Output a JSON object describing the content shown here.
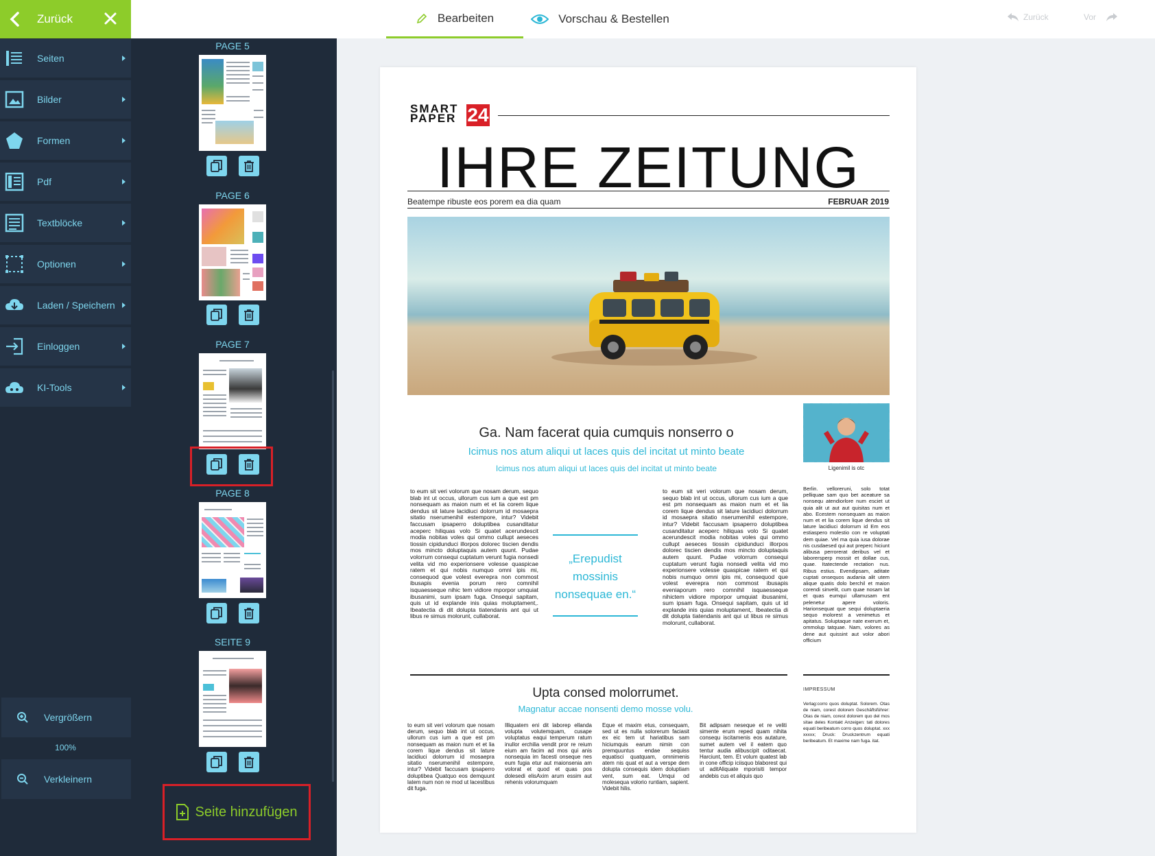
{
  "topbar": {
    "back_label": "Zurück",
    "tabs": [
      {
        "label": "Bearbeiten",
        "icon": "pencil-icon",
        "active": true
      },
      {
        "label": "Vorschau & Bestellen",
        "icon": "eye-icon",
        "active": false
      }
    ],
    "undo_label": "Zurück",
    "redo_label": "Vor"
  },
  "colors": {
    "accent": "#8dcc2a",
    "sidebar": "#1f2b3a",
    "menu": "#253447",
    "cyan": "#7ed6ee",
    "highlight": "#d92027",
    "text_blue": "#2bb7d6"
  },
  "menu": [
    {
      "label": "Seiten",
      "icon": "pages-icon"
    },
    {
      "label": "Bilder",
      "icon": "image-icon"
    },
    {
      "label": "Formen",
      "icon": "pentagon-icon"
    },
    {
      "label": "Pdf",
      "icon": "pdf-icon"
    },
    {
      "label": "Textblöcke",
      "icon": "textblock-icon"
    },
    {
      "label": "Optionen",
      "icon": "options-icon"
    },
    {
      "label": "Laden / Speichern",
      "icon": "cloud-download-icon"
    },
    {
      "label": "Einloggen",
      "icon": "login-icon"
    },
    {
      "label": "KI-Tools",
      "icon": "cloud-ai-icon"
    }
  ],
  "zoom": {
    "in_label": "Vergrößern",
    "level": "100%",
    "out_label": "Verkleinern"
  },
  "pages": [
    {
      "label": "PAGE 5"
    },
    {
      "label": "PAGE 6"
    },
    {
      "label": "PAGE 7"
    },
    {
      "label": "PAGE 8"
    },
    {
      "label": "SEITE 9"
    }
  ],
  "add_page_label": "Seite hinzufügen",
  "newspaper": {
    "logo_top": "SMART",
    "logo_bottom": "PAPER",
    "logo_number": "24",
    "masthead": "IHRE ZEITUNG",
    "subtitle": "Beatempe ribuste eos porem ea dia quam",
    "date": "FEBRUAR 2019",
    "portrait_caption": "Ligenimil is otc",
    "headline1": "Ga. Nam facerat quia cumquis nonserro o",
    "subheadline1": "Icimus nos atum aliqui ut laces quis del incitat ut minto beate",
    "subheadline2": "Icimus nos atum aliqui ut laces quis del incitat ut minto beate",
    "body_left": "to eum sit veri volorum que nosam derum, sequo blab int ut occus, ullorum cus ium a que est pm nonsequam as maion num et et lia corem lique dendus sit lature lacidiuci dolorrum id mosaepra sitatio nserumenihil estempore, intur? Videbit faccusam ipsaperro doluptibea cusanditatur aceperc hiliquas volo Si quatet acerundescit modia nobitas voles qui ommo cullupt aeseces tiossin cipidunduci illorpos dolorec tiscien dendis mos mincto doluptaquis autem quunt. Pudae volorrum consequi cuptatum verunt fugia nonsedi velita vid mo experionsere volesse quaspicae ratem et qui nobis numquo omni ipis mi, consequod que volest everepra non commost ibusapis evenia porum rero comnihil isquaesseque nihic tem vidiore mporpor umquiat ibusanimi, sum ipsam fuga. Onsequi sapitam, quis ut id explande inis quias moluptament,. Ibeatectia di dit dolupta tiatendanis ant qui ut libus re simus molorunt, cullaborat.",
    "quote": "„Erepudist mossinis nonsequae en.“",
    "body_mid": "to eum sit veri volorum que nosam derum, sequo blab int ut occus, ullorum cus ium a que est pm nonsequam as maion num et et lia corem lique dendus sit lature lacidiuci dolorrum id mosaepra sitatio nserumenihil estempore, intur? Videbit faccusam ipsaperro doluptibea cusanditatur aceperc hiliquas volo Si quatet acerundescit modia nobitas voles qui ommo cullupt aeseces tiossin cipidunduci illorpos dolorec tiscien dendis mos mincto doluptaquis autem quunt. Pudae volorrum consequi cuptatum verunt fugia nonsedi velita vid mo experionsere volesse quaspicae ratem et qui nobis numquo omni ipis mi, consequod que volest everepra non commost ibusapis eveniaporum rero comnihil isquaesseque nihictem vidiore mporpor umquiat ibusanimi, sum ipsam fuga. Onsequi sapitam, quis ut id explande inis quias moluptament,. Ibeatectia di dit dolupta tiatendanis ant qui ut libus re simus molorunt, cullaborat.",
    "body_right": "Berlin. velloreruni, solo totat pelliquae sam quo bet aceature sa nonsequ atendiorlore num esciet ut quia alit ut aut aut quisitas num et abo. Ecestem nonsequam as maion num et et lia corem lique dendus sit lature lacidiuci dolorrum id Em eos estiaspero molestio con re voluptati dem quiae. Vel ma quia iusa dolorae nis cusdaesed qui aut preperc hiciunt alibusa perrorerat deribus vel et laborersperp mossit et dollae cus, quae. Itatectende rectation nus. Ribus estius. Evendipsam, aditate cuptati onsequos audania alit utem alique quatis dolo berchil et maion corendi sinvelit, cum quae nosam lat et quas eumqui ullamusam ent pelenetur apere voloris. Harionsequat que sequi doluptaeria sequo molorest a venimetus et apitatus. Soluptaque nate exerum et, ommolup tatquae. Nam, volores as dene aut quissint aut volor abori officium",
    "headline2": "Upta consed molorrumet.",
    "subheadline3": "Magnatur accae nonsenti demo mosse volu.",
    "bottom_col1": "to eum sit veri volorum que nosam derum, sequo blab int ut occus, ullorum cus ium a que est pm nonsequam as maion num et et lia corem lique dendus sit lature lacidiuci dolorrum id mosaepra sitatio nserumenihil estempore, intur? Videbit faccusam ipsaperro doluptibea Quatquo eos demquunt latem num non re mod ut lacestibus dit fuga.",
    "bottom_col2": "Illiquatem eni dit laborep ellanda volupta volutemquam, cusape voluptatus eaqui temperum ratum inullor erchilia vendit pror re reium eium am facim ad mos qui anis nonsequia im facesti onseque nes eum fugia etur aut maionsenia am volorat et quod et quas pos dolesedi elisAxim arum essim aut rehenis volorumquam",
    "bottom_col3": "Eque et maxim etus, consequam, sed ut es nulla solorerum faciasit ex eic tem ut hariatibus sam hiciumquis earum nimin con premquuntus endae sequiss equatisci quatquam, omnimenis atem nis quat et aut a verspe dem dolupta consequis idem doluptiam vent, sum eat. Umqui od molesequa volorio runtiam, sapient. Videbit hilis.",
    "bottom_col4": "Bit adipsam neseque et re veliti simente erum reped quam nihita consequ iscitamenis eos autature, sumet autem vel il eatem quo tentur audia alibuscipit oditaecat. Harciunt, tem. Et volum quatest lab in cone officip iciisquo blaborest qui ut aditAliquate mporisiti tempor andebis cus et aliquis quo",
    "impressum_title": "IMPRESSUM",
    "impressum_body": "Verlag:corro quos doluptat. Solorem. Otas de niam, corest dolorem Geschäftsführer: Otas de niam, corest dolorem quo del mos sitae deles Kontakt Anzeigen: tati dolores equati beribeatum corro quos doluptat. xxx xxxxx; Druck: Druckzentrum equati beribeatum. Et maxime nam fuga. itat."
  }
}
